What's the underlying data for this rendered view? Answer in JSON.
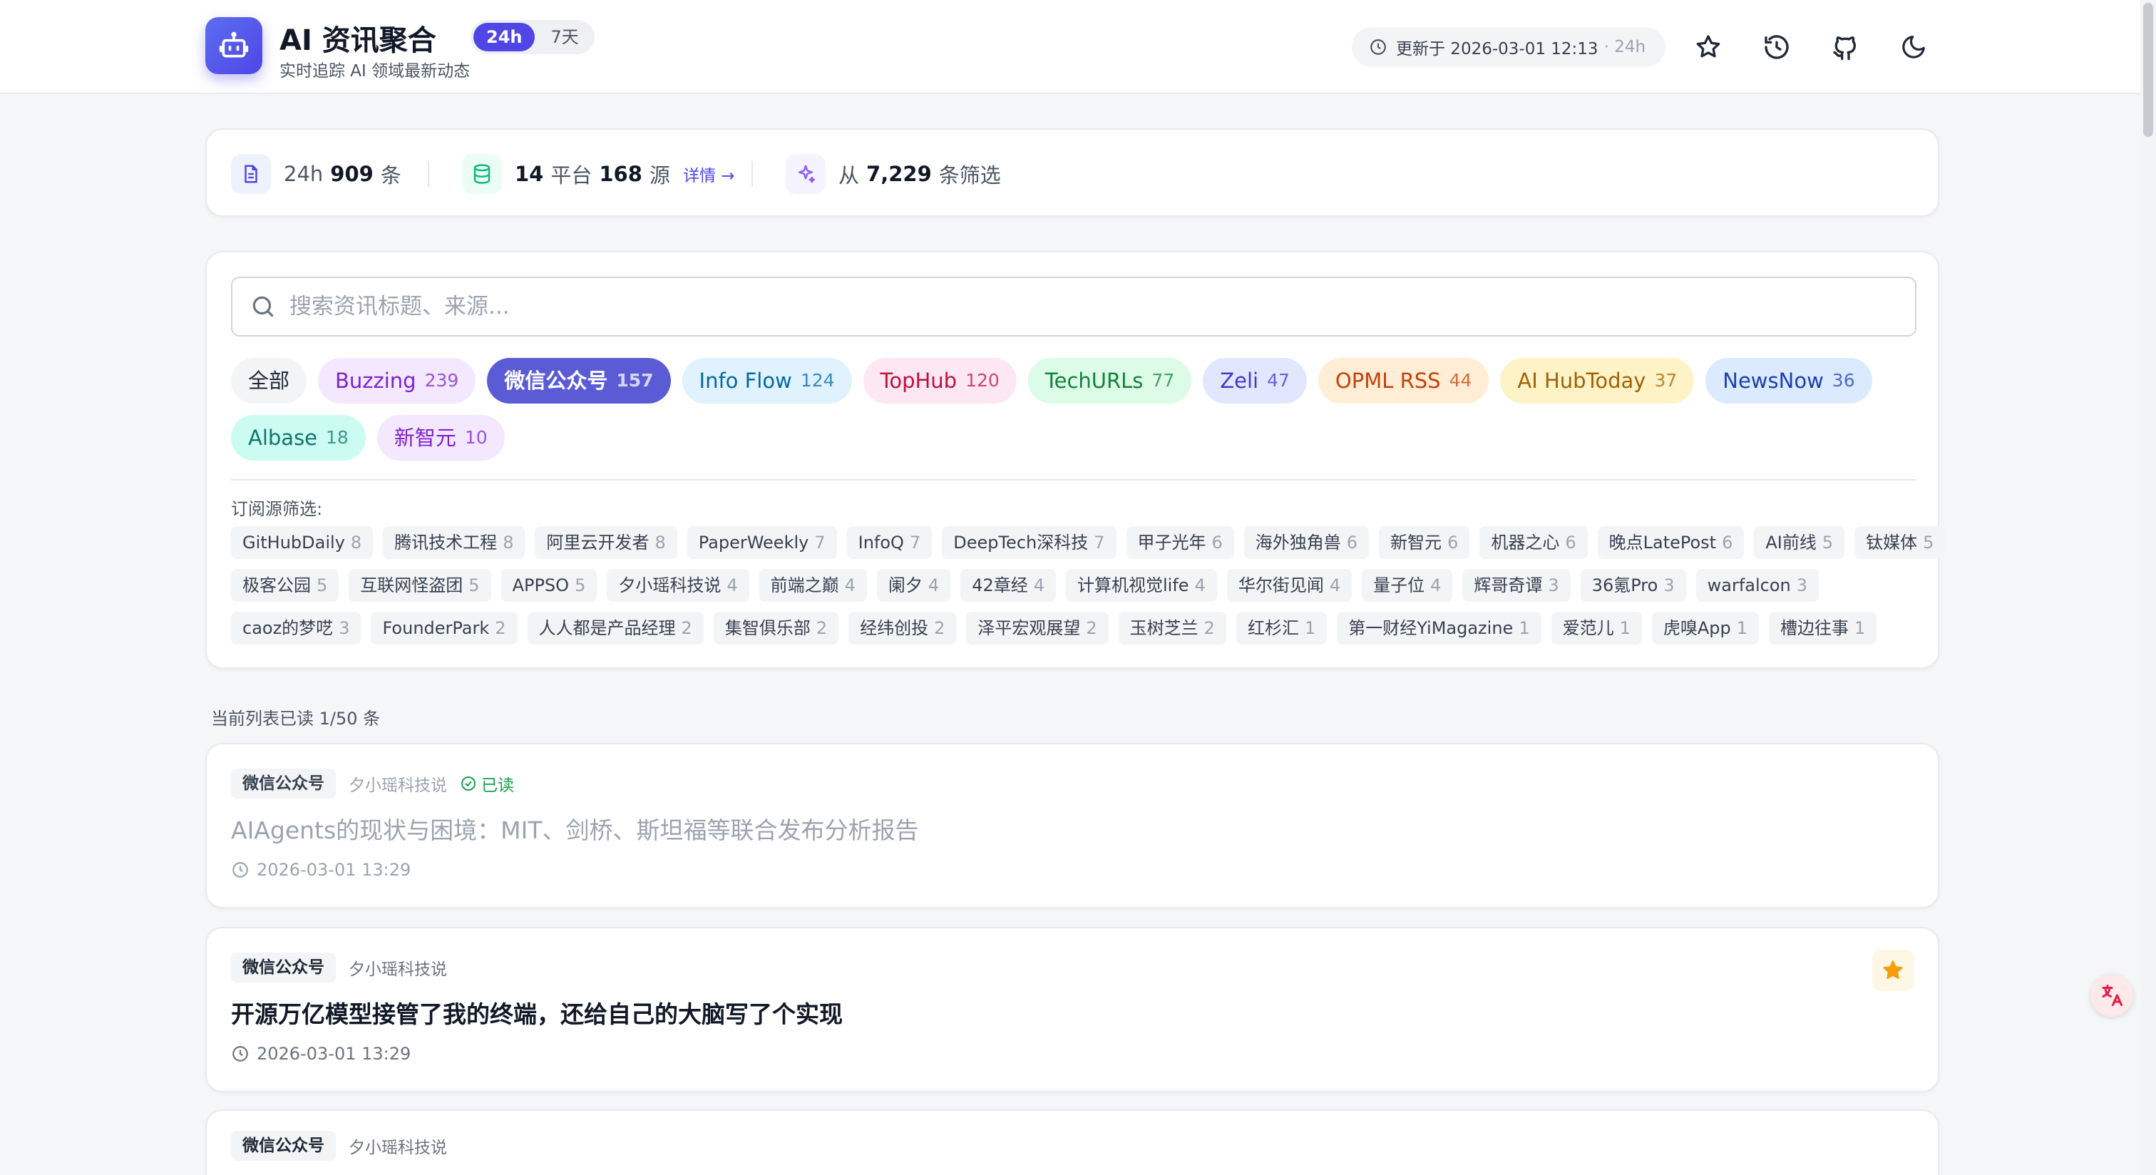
{
  "header": {
    "title": "AI 资讯聚合",
    "subtitle": "实时追踪 AI 领域最新动态",
    "ranges": [
      {
        "label": "24h",
        "active": true
      },
      {
        "label": "7天",
        "active": false
      }
    ],
    "updated_text": "更新于 2026-03-01 12:13",
    "updated_range": "· 24h",
    "icons": [
      "star-icon",
      "history-icon",
      "github-icon",
      "moon-icon"
    ]
  },
  "stats": {
    "items_prefix": "24h",
    "items_count": "909",
    "items_suffix": "条",
    "platforms_count": "14",
    "platforms_label": "平台",
    "sources_count": "168",
    "sources_label": "源",
    "details_link": "详情 →",
    "filtered_prefix": "从",
    "filtered_count": "7,229",
    "filtered_suffix": "条筛选"
  },
  "search": {
    "placeholder": "搜索资讯标题、来源..."
  },
  "platforms": [
    {
      "label": "全部",
      "count": "",
      "bg": "#f3f4f6",
      "fg": "#1f2937",
      "active": false
    },
    {
      "label": "Buzzing",
      "count": "239",
      "bg": "#f3e8ff",
      "fg": "#7e22ce",
      "active": false
    },
    {
      "label": "微信公众号",
      "count": "157",
      "bg": "#5b5bd6",
      "fg": "#ffffff",
      "active": true
    },
    {
      "label": "Info Flow",
      "count": "124",
      "bg": "#e0f2fe",
      "fg": "#0369a1",
      "active": false
    },
    {
      "label": "TopHub",
      "count": "120",
      "bg": "#fce7f3",
      "fg": "#be123c",
      "active": false
    },
    {
      "label": "TechURLs",
      "count": "77",
      "bg": "#dcfce7",
      "fg": "#15803d",
      "active": false
    },
    {
      "label": "Zeli",
      "count": "47",
      "bg": "#e0e7ff",
      "fg": "#4338ca",
      "active": false
    },
    {
      "label": "OPML RSS",
      "count": "44",
      "bg": "#ffedd5",
      "fg": "#c2410c",
      "active": false
    },
    {
      "label": "AI HubToday",
      "count": "37",
      "bg": "#fef3c7",
      "fg": "#a16207",
      "active": false
    },
    {
      "label": "NewsNow",
      "count": "36",
      "bg": "#dbeafe",
      "fg": "#1e40af",
      "active": false
    },
    {
      "label": "Albase",
      "count": "18",
      "bg": "#ccfbf1",
      "fg": "#0f766e",
      "active": false
    },
    {
      "label": "新智元",
      "count": "10",
      "bg": "#f3e8ff",
      "fg": "#7e22ce",
      "active": false
    }
  ],
  "sources_label": "订阅源筛选:",
  "sources": [
    {
      "label": "GitHubDaily",
      "count": "8"
    },
    {
      "label": "腾讯技术工程",
      "count": "8"
    },
    {
      "label": "阿里云开发者",
      "count": "8"
    },
    {
      "label": "PaperWeekly",
      "count": "7"
    },
    {
      "label": "InfoQ",
      "count": "7"
    },
    {
      "label": "DeepTech深科技",
      "count": "7"
    },
    {
      "label": "甲子光年",
      "count": "6"
    },
    {
      "label": "海外独角兽",
      "count": "6"
    },
    {
      "label": "新智元",
      "count": "6"
    },
    {
      "label": "机器之心",
      "count": "6"
    },
    {
      "label": "晚点LatePost",
      "count": "6"
    },
    {
      "label": "AI前线",
      "count": "5"
    },
    {
      "label": "钛媒体",
      "count": "5"
    },
    {
      "label": "极客公园",
      "count": "5"
    },
    {
      "label": "互联网怪盗团",
      "count": "5"
    },
    {
      "label": "APPSO",
      "count": "5"
    },
    {
      "label": "夕小瑶科技说",
      "count": "4"
    },
    {
      "label": "前端之巅",
      "count": "4"
    },
    {
      "label": "阑夕",
      "count": "4"
    },
    {
      "label": "42章经",
      "count": "4"
    },
    {
      "label": "计算机视觉life",
      "count": "4"
    },
    {
      "label": "华尔街见闻",
      "count": "4"
    },
    {
      "label": "量子位",
      "count": "4"
    },
    {
      "label": "辉哥奇谭",
      "count": "3"
    },
    {
      "label": "36氪Pro",
      "count": "3"
    },
    {
      "label": "warfalcon",
      "count": "3"
    },
    {
      "label": "caoz的梦呓",
      "count": "3"
    },
    {
      "label": "FounderPark",
      "count": "2"
    },
    {
      "label": "人人都是产品经理",
      "count": "2"
    },
    {
      "label": "集智俱乐部",
      "count": "2"
    },
    {
      "label": "经纬创投",
      "count": "2"
    },
    {
      "label": "泽平宏观展望",
      "count": "2"
    },
    {
      "label": "玉树芝兰",
      "count": "2"
    },
    {
      "label": "红杉汇",
      "count": "1"
    },
    {
      "label": "第一财经YiMagazine",
      "count": "1"
    },
    {
      "label": "爱范儿",
      "count": "1"
    },
    {
      "label": "虎嗅App",
      "count": "1"
    },
    {
      "label": "槽边往事",
      "count": "1"
    }
  ],
  "read_status": "当前列表已读 1/50 条",
  "items": [
    {
      "platform": "微信公众号",
      "source": "夕小瑶科技说",
      "read_label": "已读",
      "title": "AIAgents的现状与困境：MIT、剑桥、斯坦福等联合发布分析报告",
      "time": "2026-03-01 13:29"
    },
    {
      "platform": "微信公众号",
      "source": "夕小瑶科技说",
      "title": "开源万亿模型接管了我的终端，还给自己的大脑写了个实现",
      "time": "2026-03-01 13:29"
    },
    {
      "platform": "微信公众号",
      "source": "夕小瑶科技说"
    }
  ],
  "colors": {
    "accent": "#4f46e5",
    "star": "#f59e0b",
    "read": "#16a34a"
  }
}
